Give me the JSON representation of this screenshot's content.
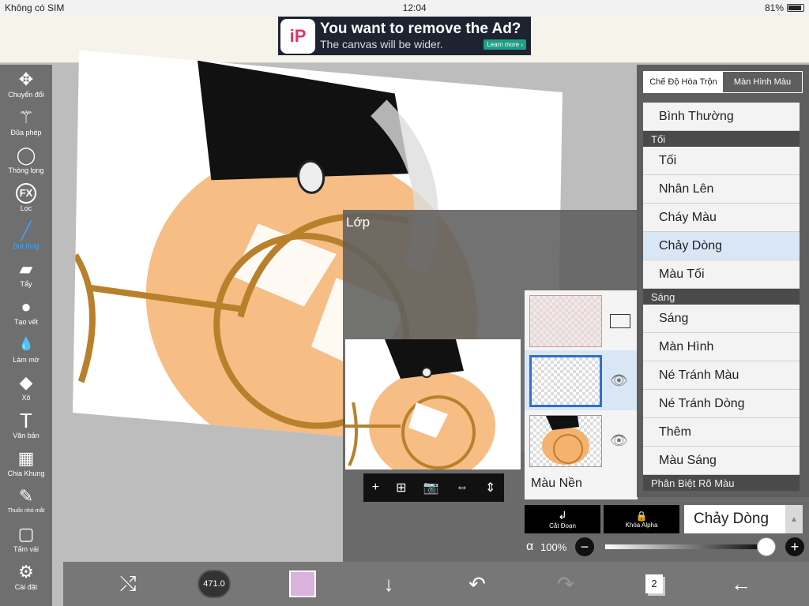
{
  "status": {
    "carrier": "Không có SIM",
    "time": "12:04",
    "battery": "81%"
  },
  "ad": {
    "title": "You want to remove the Ad?",
    "subtitle": "The canvas will be wider.",
    "cta": "Learn more ›",
    "logo": "iP"
  },
  "tools": [
    {
      "label": "Chuyển đổi",
      "icon": "✥"
    },
    {
      "label": "Đũa phép",
      "icon": "⚚"
    },
    {
      "label": "Thòng lọng",
      "icon": "◯"
    },
    {
      "label": "Lọc",
      "icon": "FX"
    },
    {
      "label": "Bút lông",
      "icon": "╱"
    },
    {
      "label": "Tẩy",
      "icon": "▰"
    },
    {
      "label": "Tạo vết",
      "icon": "●"
    },
    {
      "label": "Làm mờ",
      "icon": "💧"
    },
    {
      "label": "Xô",
      "icon": "◆"
    },
    {
      "label": "Văn bản",
      "icon": "T"
    },
    {
      "label": "Chia Khung",
      "icon": "▦"
    },
    {
      "label": "Thuốc nhỏ mắt",
      "icon": "✎"
    },
    {
      "label": "Tấm vải",
      "icon": "▢"
    },
    {
      "label": "Cài đặt",
      "icon": "⚙"
    }
  ],
  "layer_panel": {
    "title": "Lớp",
    "background_label": "Màu Nền"
  },
  "layer_buttons": [
    "+",
    "⊞",
    "📷",
    "⇔",
    "⇕"
  ],
  "layer_controls": {
    "clip_label": "Cắt Đoạn",
    "alpha_lock_label": "Khóa Alpha",
    "blend_mode": "Chảy Dòng"
  },
  "opacity": {
    "symbol": "α",
    "value": "100%",
    "fraction": 1.0
  },
  "blend_tabs": [
    "Chế Độ Hòa Trộn",
    "Màn Hình Màu"
  ],
  "blend_list": [
    {
      "type": "item",
      "label": "Bình Thường"
    },
    {
      "type": "head",
      "label": "Tối"
    },
    {
      "type": "item",
      "label": "Tối"
    },
    {
      "type": "item",
      "label": "Nhân Lên"
    },
    {
      "type": "item",
      "label": "Cháy Màu"
    },
    {
      "type": "item",
      "label": "Chảy Dòng",
      "selected": true
    },
    {
      "type": "item",
      "label": "Màu Tối"
    },
    {
      "type": "head",
      "label": "Sáng"
    },
    {
      "type": "item",
      "label": "Sáng"
    },
    {
      "type": "item",
      "label": "Màn Hình"
    },
    {
      "type": "item",
      "label": "Né Tránh Màu"
    },
    {
      "type": "item",
      "label": "Né Tránh Dòng"
    },
    {
      "type": "item",
      "label": "Thêm"
    },
    {
      "type": "item",
      "label": "Màu Sáng"
    },
    {
      "type": "head",
      "label": "Phân Biệt Rõ Màu"
    }
  ],
  "bottom": {
    "brush_size": "471.0",
    "layer_count": "2",
    "color": "#d9b3dc"
  },
  "colors": {
    "accent": "#3ba2ff",
    "skin": "#f4b26e",
    "outline": "#b9802c",
    "hair": "#111111"
  }
}
